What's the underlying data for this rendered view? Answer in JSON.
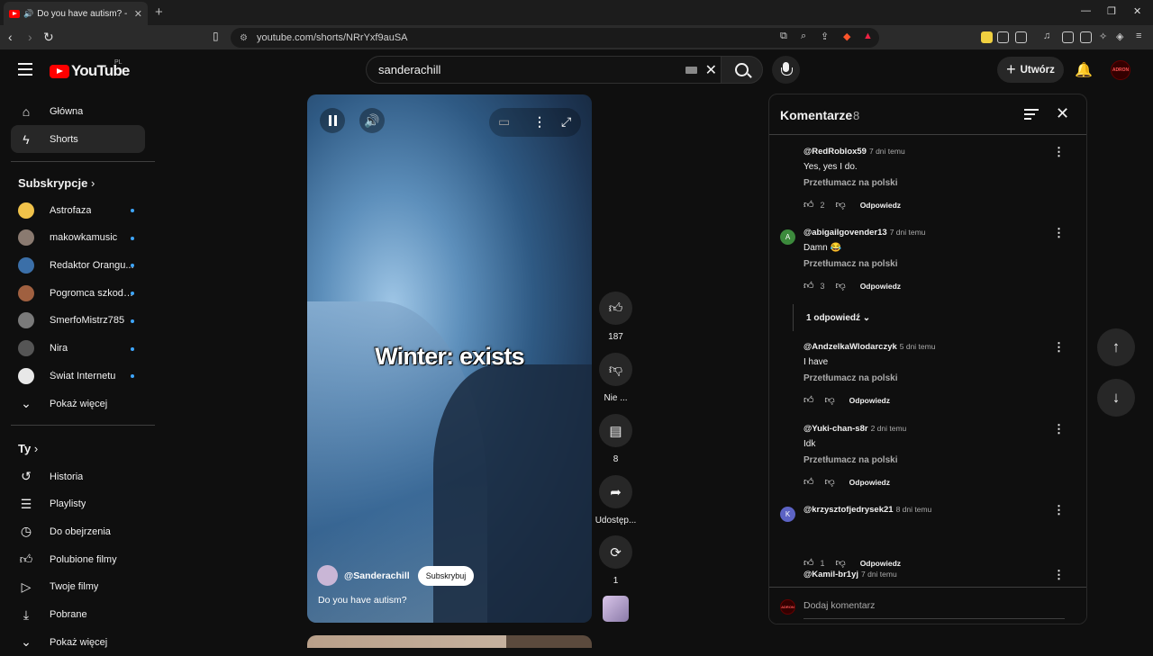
{
  "browser": {
    "tab_title": "Do you have autism? - YouTube",
    "new_tab": "+",
    "url": "youtube.com/shorts/NRrYxf9auSA"
  },
  "header": {
    "logo_text": "YouTube",
    "logo_region": "PL",
    "search_value": "sanderachill",
    "create_label": "Utwórz",
    "avatar_text": "ADRON"
  },
  "sidebar": {
    "main": [
      {
        "label": "Główna",
        "icon": "home-icon"
      },
      {
        "label": "Shorts",
        "icon": "shorts-icon"
      }
    ],
    "subs_header": "Subskrypcje",
    "subs": [
      {
        "label": "Astrofaza",
        "color": "#f0c24a"
      },
      {
        "label": "makowkamusic",
        "color": "#8a7a70"
      },
      {
        "label": "Redaktor Orangu...",
        "color": "#3b6fa8"
      },
      {
        "label": "Pogromca szkodni...",
        "color": "#a06040"
      },
      {
        "label": "SmerfoMistrz785",
        "color": "#7a7a7a"
      },
      {
        "label": "Nira",
        "color": "#555555"
      },
      {
        "label": "Świat Internetu",
        "color": "#e8e8e8"
      }
    ],
    "show_more": "Pokaż więcej",
    "you_header": "Ty",
    "you": [
      {
        "label": "Historia",
        "icon": "history-icon"
      },
      {
        "label": "Playlisty",
        "icon": "playlists-icon"
      },
      {
        "label": "Do obejrzenia",
        "icon": "watch-later-icon"
      },
      {
        "label": "Polubione filmy",
        "icon": "liked-icon"
      },
      {
        "label": "Twoje filmy",
        "icon": "your-videos-icon"
      },
      {
        "label": "Pobrane",
        "icon": "download-icon"
      },
      {
        "label": "Pokaż więcej",
        "icon": "chevron-down-icon"
      }
    ]
  },
  "video": {
    "caption": "Winter: exists",
    "channel": "@Sanderachill",
    "subscribe": "Subskrybuj",
    "title": "Do you have autism?"
  },
  "actions": {
    "likes": "187",
    "dislike": "Nie ...",
    "comments": "8",
    "share": "Udostęp...",
    "remix": "1"
  },
  "comments": {
    "title": "Komentarze",
    "count": "8",
    "translate": "Przetłumacz na polski",
    "reply": "Odpowiedz",
    "items": [
      {
        "author": "@RedRoblox59",
        "time": "7 dni temu",
        "text": "Yes, yes I do.",
        "likes": "2",
        "avatar": "",
        "color": ""
      },
      {
        "author": "@abigailgovender13",
        "time": "7 dni temu",
        "text": "Damn 😂",
        "likes": "3",
        "avatar": "A",
        "color": "#3c8a3c"
      },
      {
        "author": "@AndzelkaWlodarczyk",
        "time": "5 dni temu",
        "text": "I have",
        "likes": "",
        "avatar": "",
        "color": ""
      },
      {
        "author": "@Yuki-chan-s8r",
        "time": "2 dni temu",
        "text": "Idk",
        "likes": "",
        "avatar": "",
        "color": ""
      },
      {
        "author": "@krzysztofjedrysek21",
        "time": "8 dni temu",
        "text": "",
        "likes": "1",
        "avatar": "K",
        "color": "#5c63c4"
      },
      {
        "author": "@Kamil-br1yj",
        "time": "7 dni temu",
        "text": "",
        "likes": "",
        "avatar": "",
        "color": ""
      }
    ],
    "replies_label": "1 odpowiedź",
    "add_placeholder": "Dodaj komentarz",
    "footer_avatar": "ADRON"
  }
}
